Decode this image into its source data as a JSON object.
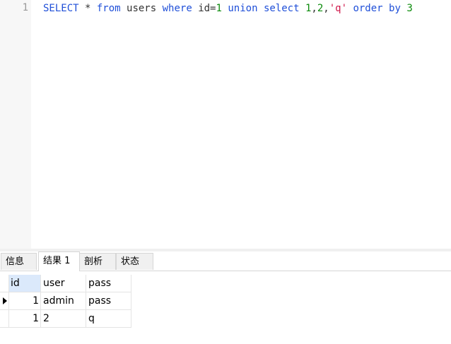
{
  "editor": {
    "line_number": "1",
    "tokens": [
      {
        "text": "SELECT",
        "kind": "kw"
      },
      {
        "text": " * ",
        "kind": "id"
      },
      {
        "text": "from",
        "kind": "kw"
      },
      {
        "text": " users ",
        "kind": "id"
      },
      {
        "text": "where",
        "kind": "kw"
      },
      {
        "text": " id=",
        "kind": "id"
      },
      {
        "text": "1",
        "kind": "num"
      },
      {
        "text": " ",
        "kind": "id"
      },
      {
        "text": "union",
        "kind": "kw"
      },
      {
        "text": " ",
        "kind": "id"
      },
      {
        "text": "select",
        "kind": "kw"
      },
      {
        "text": " ",
        "kind": "id"
      },
      {
        "text": "1",
        "kind": "num"
      },
      {
        "text": ",",
        "kind": "id"
      },
      {
        "text": "2",
        "kind": "num"
      },
      {
        "text": ",",
        "kind": "id"
      },
      {
        "text": "'q'",
        "kind": "str"
      },
      {
        "text": " ",
        "kind": "id"
      },
      {
        "text": "order by",
        "kind": "kw"
      },
      {
        "text": " ",
        "kind": "id"
      },
      {
        "text": "3",
        "kind": "num"
      }
    ]
  },
  "colors": {
    "keyword": "#1f4fd8",
    "number": "#0b8b0b",
    "string": "#d0184b",
    "identifier": "#333333"
  },
  "tabs": [
    {
      "label": "信息",
      "active": false
    },
    {
      "label": "结果 1",
      "active": true
    },
    {
      "label": "剖析",
      "active": false
    },
    {
      "label": "状态",
      "active": false
    }
  ],
  "results": {
    "columns": [
      "id",
      "user",
      "pass"
    ],
    "rows": [
      {
        "id": "1",
        "user": "admin",
        "pass": "pass",
        "current": true
      },
      {
        "id": "1",
        "user": "2",
        "pass": "q",
        "current": false
      }
    ]
  }
}
